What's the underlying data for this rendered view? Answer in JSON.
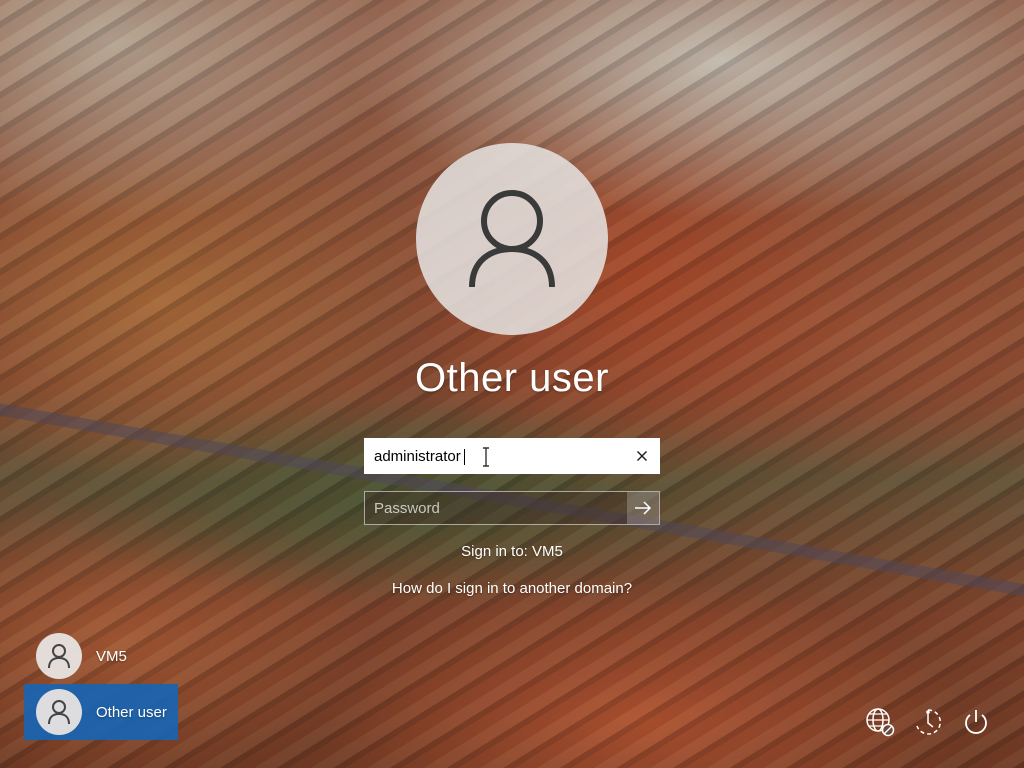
{
  "account": {
    "title": "Other user",
    "username_value": "administrator",
    "password_placeholder": "Password",
    "sign_in_to": "Sign in to: VM5",
    "domain_help_link": "How do I sign in to another domain?"
  },
  "user_list": [
    {
      "label": "VM5",
      "selected": false
    },
    {
      "label": "Other user",
      "selected": true
    }
  ],
  "system_tray": {
    "icons": [
      "network-icon",
      "ease-of-access-icon",
      "power-icon"
    ]
  },
  "colors": {
    "selected_tile": "#1e6fb5",
    "text": "#ffffff"
  }
}
